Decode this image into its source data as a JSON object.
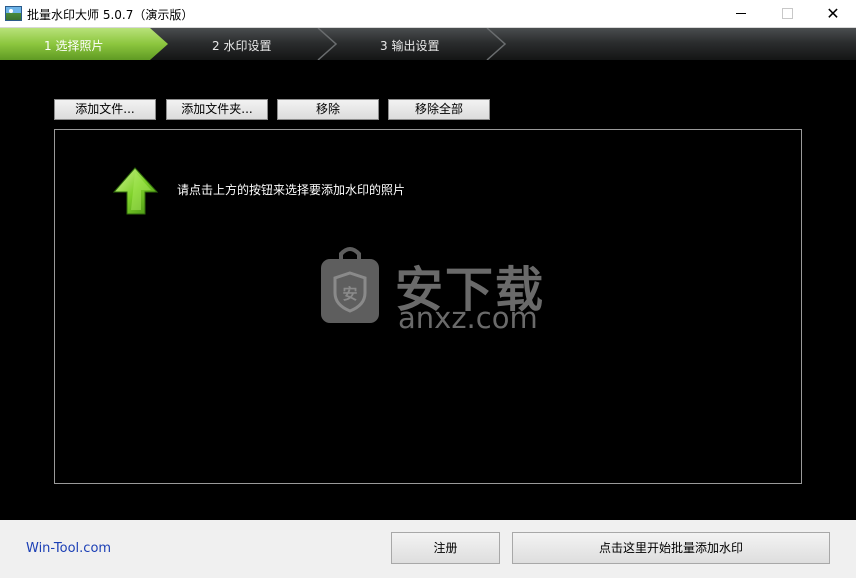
{
  "window": {
    "title": "批量水印大师 5.0.7（演示版）",
    "controls": {
      "minimize": "minimize",
      "maximize": "maximize",
      "close": "✕"
    }
  },
  "steps": [
    {
      "label": "1 选择照片",
      "active": true
    },
    {
      "label": "2 水印设置",
      "active": false
    },
    {
      "label": "3 输出设置",
      "active": false
    }
  ],
  "toolbar": {
    "add_files": "添加文件...",
    "add_folder": "添加文件夹...",
    "remove": "移除",
    "remove_all": "移除全部"
  },
  "list": {
    "hint": "请点击上方的按钮来选择要添加水印的照片",
    "hint_icon": "green-up-arrow-icon",
    "watermark_cn": "安下载",
    "watermark_en": "anxz.com"
  },
  "footer": {
    "site_link": "Win-Tool.com",
    "register_label": "注册",
    "start_label": "点击这里开始批量添加水印"
  },
  "colors": {
    "active_step": "#8cc63e",
    "step_bar": "#2b2d2e",
    "main_bg": "#000000",
    "link": "#1b3fb5"
  }
}
